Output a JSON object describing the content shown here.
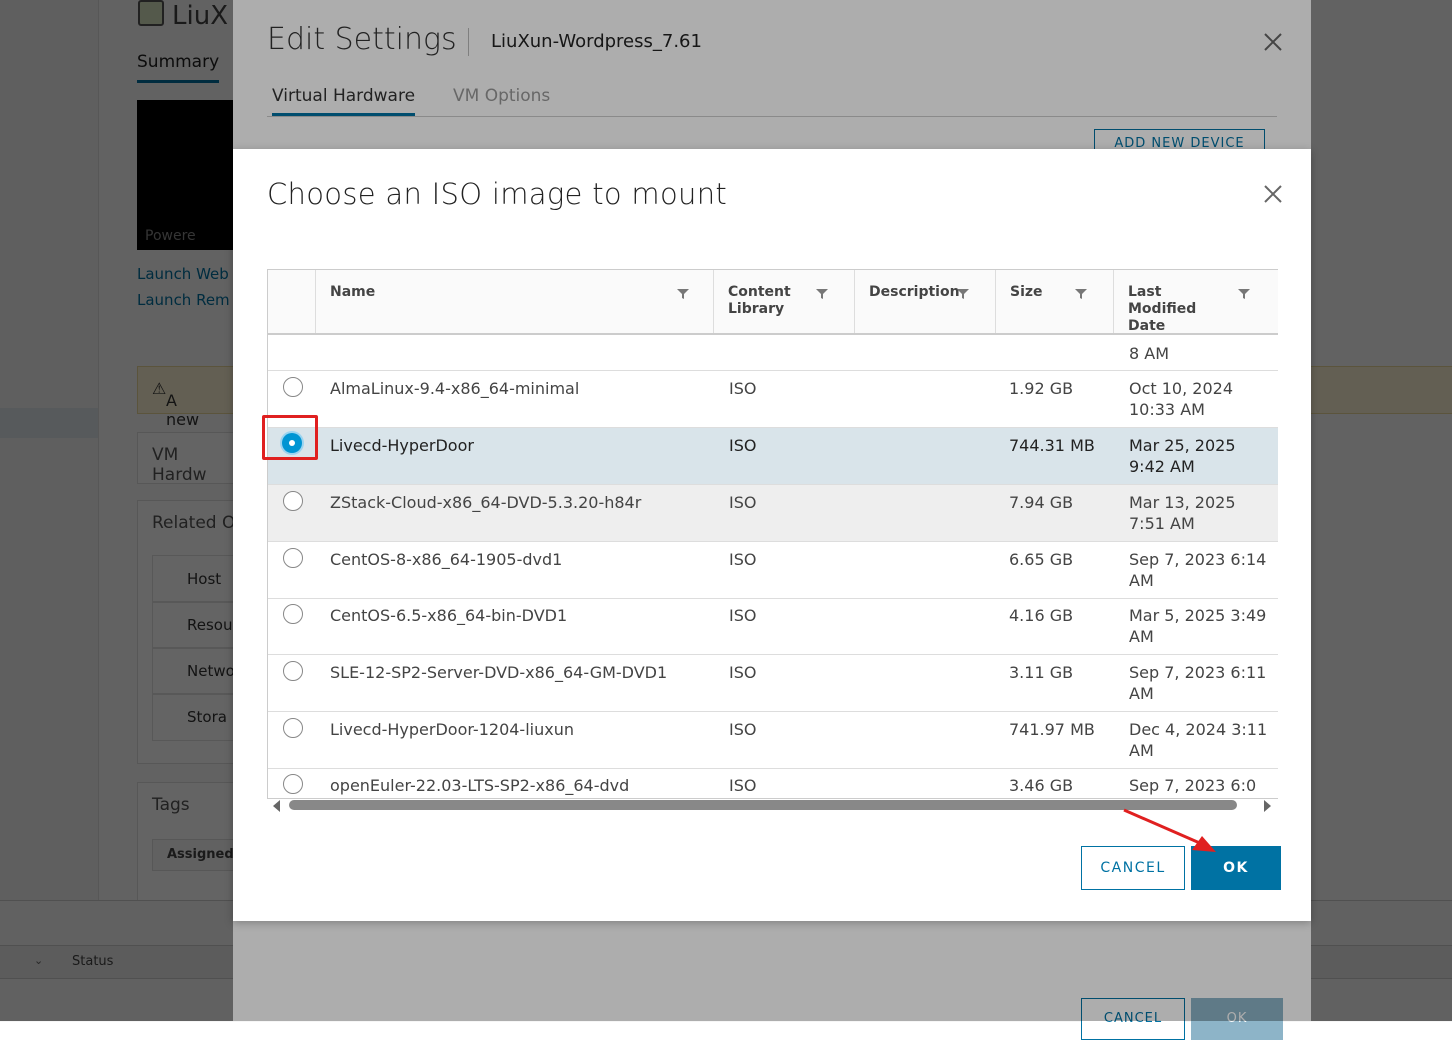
{
  "background": {
    "vm_title": "LiuX",
    "summary_tab": "Summary",
    "console_status": "Powere",
    "links": [
      "Launch Web",
      "Launch Rem"
    ],
    "warning_text": "A new",
    "vm_hardware_card": "VM Hardw",
    "related_card": "Related O",
    "related_items": [
      "Host",
      "Resou",
      "Netwo",
      "Stora"
    ],
    "tags_card": "Tags",
    "tags_col": "Assigned",
    "status_col": "Status"
  },
  "edit_settings": {
    "title": "Edit Settings",
    "vm_name": "LiuXun-Wordpress_7.61",
    "tabs": [
      {
        "label": "Virtual Hardware",
        "active": true
      },
      {
        "label": "VM Options",
        "active": false
      }
    ],
    "add_device_label": "ADD NEW DEVICE",
    "cancel_label": "CANCEL",
    "ok_label": "OK"
  },
  "iso_dialog": {
    "title": "Choose an ISO image to mount",
    "columns": [
      {
        "label": "Name",
        "filter": true
      },
      {
        "label": "Content Library",
        "filter": true
      },
      {
        "label": "Description",
        "filter": true
      },
      {
        "label": "Size",
        "filter": true
      },
      {
        "label": "Last Modified Date",
        "filter": true
      }
    ],
    "partial_row": {
      "date_tail": "8 AM"
    },
    "rows": [
      {
        "name": "AlmaLinux-9.4-x86_64-minimal",
        "library": "ISO",
        "description": "",
        "size": "1.92 GB",
        "date": "Oct 10, 2024 10:33 AM",
        "selected": false
      },
      {
        "name": "Livecd-HyperDoor",
        "library": "ISO",
        "description": "",
        "size": "744.31 MB",
        "date": "Mar 25, 2025 9:42 AM",
        "selected": true
      },
      {
        "name": "ZStack-Cloud-x86_64-DVD-5.3.20-h84r",
        "library": "ISO",
        "description": "",
        "size": "7.94 GB",
        "date": "Mar 13, 2025 7:51 AM",
        "selected": false
      },
      {
        "name": "CentOS-8-x86_64-1905-dvd1",
        "library": "ISO",
        "description": "",
        "size": "6.65 GB",
        "date": "Sep 7, 2023 6:14 AM",
        "selected": false
      },
      {
        "name": "CentOS-6.5-x86_64-bin-DVD1",
        "library": "ISO",
        "description": "",
        "size": "4.16 GB",
        "date": "Mar 5, 2025 3:49 AM",
        "selected": false
      },
      {
        "name": "SLE-12-SP2-Server-DVD-x86_64-GM-DVD1",
        "library": "ISO",
        "description": "",
        "size": "3.11 GB",
        "date": "Sep 7, 2023 6:11 AM",
        "selected": false
      },
      {
        "name": "Livecd-HyperDoor-1204-liuxun",
        "library": "ISO",
        "description": "",
        "size": "741.97 MB",
        "date": "Dec 4, 2024 3:11 AM",
        "selected": false
      },
      {
        "name": "openEuler-22.03-LTS-SP2-x86_64-dvd",
        "library": "ISO",
        "description": "",
        "size": "3.46 GB",
        "date": "Sep 7, 2023 6:0",
        "selected": false
      }
    ],
    "cancel_label": "CANCEL",
    "ok_label": "OK"
  },
  "colors": {
    "accent": "#0072a3",
    "selected_row": "#d9e4ea",
    "radio_checked": "#0095d3",
    "annotation": "#e02020"
  }
}
